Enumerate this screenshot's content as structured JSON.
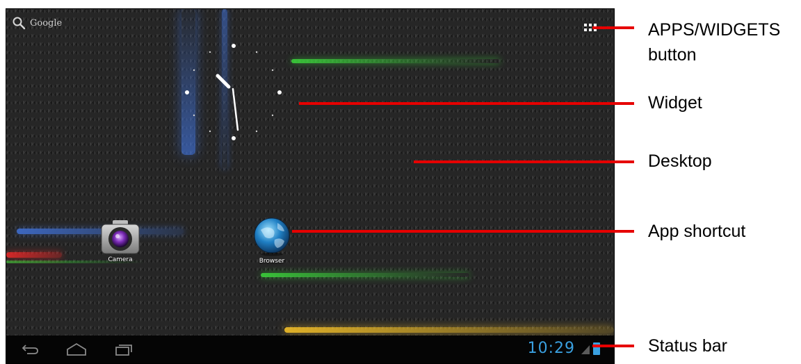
{
  "search": {
    "label": "Google"
  },
  "shortcuts": [
    {
      "label": "Camera",
      "icon": "camera-icon"
    },
    {
      "label": "Browser",
      "icon": "browser-icon"
    }
  ],
  "status_bar": {
    "time": "10:29",
    "nav_icons": [
      "back-icon",
      "home-icon",
      "recent-apps-icon"
    ]
  },
  "callouts": {
    "apps_widgets": "APPS/WIDGETS",
    "apps_widgets_line2": "button",
    "widget": "Widget",
    "desktop": "Desktop",
    "app_shortcut": "App shortcut",
    "status_bar": "Status bar"
  },
  "colors": {
    "callout_red": "#e60000",
    "clock_blue": "#3aa0e0",
    "status_bar_bg": "#050505"
  }
}
